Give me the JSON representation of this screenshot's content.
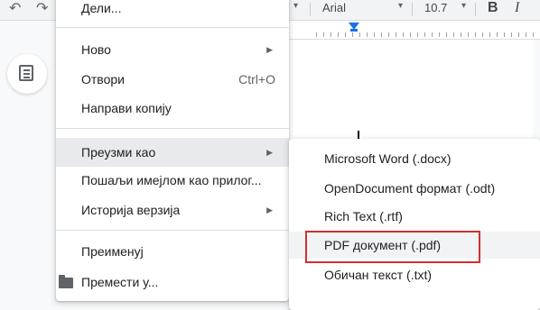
{
  "toolbar": {
    "font_name": "Arial",
    "font_size": "10.7",
    "bold_label": "B",
    "italic_label": "I"
  },
  "file_menu": {
    "items": [
      {
        "label": "Дели..."
      },
      {
        "label": "Ново",
        "submenu": true
      },
      {
        "label": "Отвори",
        "shortcut": "Ctrl+O"
      },
      {
        "label": "Направи копију"
      },
      {
        "label": "Преузми као",
        "submenu": true,
        "active": true
      },
      {
        "label": "Пошаљи имејлом као прилог..."
      },
      {
        "label": "Историја верзија",
        "submenu": true
      },
      {
        "label": "Преименуј"
      },
      {
        "label": "Премести у...",
        "icon": "folder-icon"
      }
    ],
    "arrow": "▶"
  },
  "download_submenu": {
    "items": [
      {
        "label": "Microsoft Word (.docx)"
      },
      {
        "label": "OpenDocument формат (.odt)"
      },
      {
        "label": "Rich Text (.rtf)"
      },
      {
        "label": "PDF документ (.pdf)",
        "highlighted": true
      },
      {
        "label": "Обичан текст (.txt)"
      }
    ]
  },
  "colors": {
    "highlight_border": "#d32f2f",
    "active_item_bg": "#e8eaed",
    "ruler_marker": "#1a73e8"
  }
}
